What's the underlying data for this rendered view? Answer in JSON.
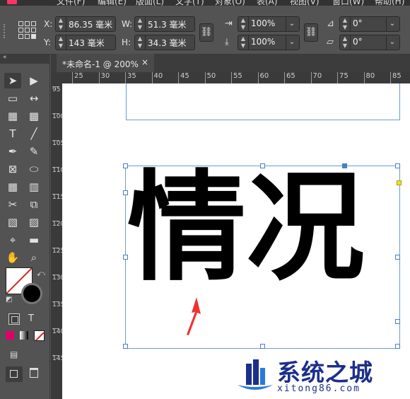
{
  "menubar": {
    "items": [
      "文件(F)",
      "编辑(E)",
      "版面(L)",
      "文字(T)",
      "对象(O)",
      "表(A)",
      "视图(V)",
      "窗口(W)",
      "帮助(H)"
    ]
  },
  "controls": {
    "x_label": "X:",
    "x_value": "86.35 毫米",
    "y_label": "Y:",
    "y_value": "143 毫米",
    "w_label": "W:",
    "w_value": "51.3 毫米",
    "h_label": "H:",
    "h_value": "34.3 毫米",
    "scale_x_value": "100%",
    "scale_y_value": "100%",
    "rotate_value": "0°",
    "shear_value": "0°"
  },
  "document_tab": {
    "title": "*未命名-1 @ 200%",
    "close": "×"
  },
  "ruler": {
    "horizontal_ticks": [
      "25",
      "30",
      "35",
      "40",
      "45",
      "50",
      "55",
      "60",
      "65",
      "70",
      "75",
      "80",
      "85"
    ],
    "vertical_ticks": [
      "95",
      "100",
      "105",
      "110",
      "115",
      "120",
      "125",
      "130",
      "135",
      "140",
      "145"
    ]
  },
  "toolbar": {
    "collapse": "«",
    "tools": [
      [
        "selection-tool",
        "direct-selection-tool"
      ],
      [
        "page-tool",
        "gap-tool"
      ],
      [
        "content-collector-tool",
        "content-placer-tool"
      ],
      [
        "type-tool",
        "line-tool"
      ],
      [
        "pen-tool",
        "pencil-tool"
      ],
      [
        "rectangle-frame-tool",
        "ellipse-tool"
      ],
      [
        "table-tool",
        "grid-tool"
      ],
      [
        "scissors-tool",
        "free-transform-tool"
      ],
      [
        "gradient-swatch-tool",
        "gradient-feather-tool"
      ],
      [
        "eyedropper-tool",
        "note-tool"
      ],
      [
        "hand-tool",
        "zoom-tool"
      ]
    ],
    "formatting_text_label": "T"
  },
  "canvas": {
    "text": "情况"
  },
  "watermark": {
    "title": "系统之城",
    "subtitle": "xitong86.com"
  },
  "colors": {
    "accent_frame": "#6a9ad8",
    "arrow": "#ee3333",
    "watermark": "#1c2f8a"
  }
}
